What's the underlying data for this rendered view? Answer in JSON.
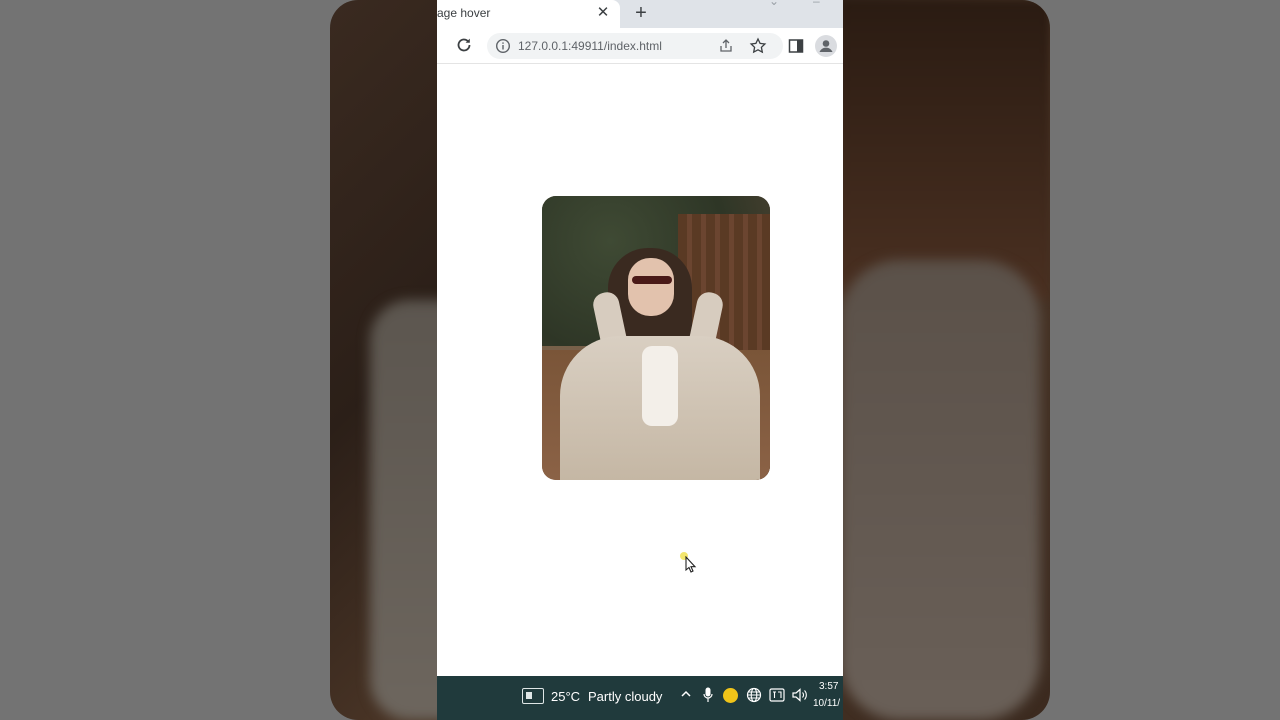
{
  "browser": {
    "tab": {
      "title": "age hover",
      "close_glyph": "✕"
    },
    "new_tab_glyph": "+",
    "address_bar": {
      "url": "127.0.0.1:49911/index.html"
    },
    "icons": [
      "reload-icon",
      "info-icon",
      "share-icon",
      "star-icon",
      "side-panel-icon",
      "profile-icon"
    ]
  },
  "page": {
    "photo_card": {
      "subject": "image",
      "alt": ""
    }
  },
  "taskbar": {
    "weather": {
      "temperature": "25°C",
      "description": "Partly cloudy"
    },
    "tray_chevron": "^",
    "clock": {
      "time": "3:57",
      "date": "10/11/"
    }
  },
  "colors": {
    "taskbar": "#203a3c",
    "tabstrip": "#dfe3e8",
    "omnibox": "#f1f3f4",
    "page_bg": "#ffffff"
  }
}
